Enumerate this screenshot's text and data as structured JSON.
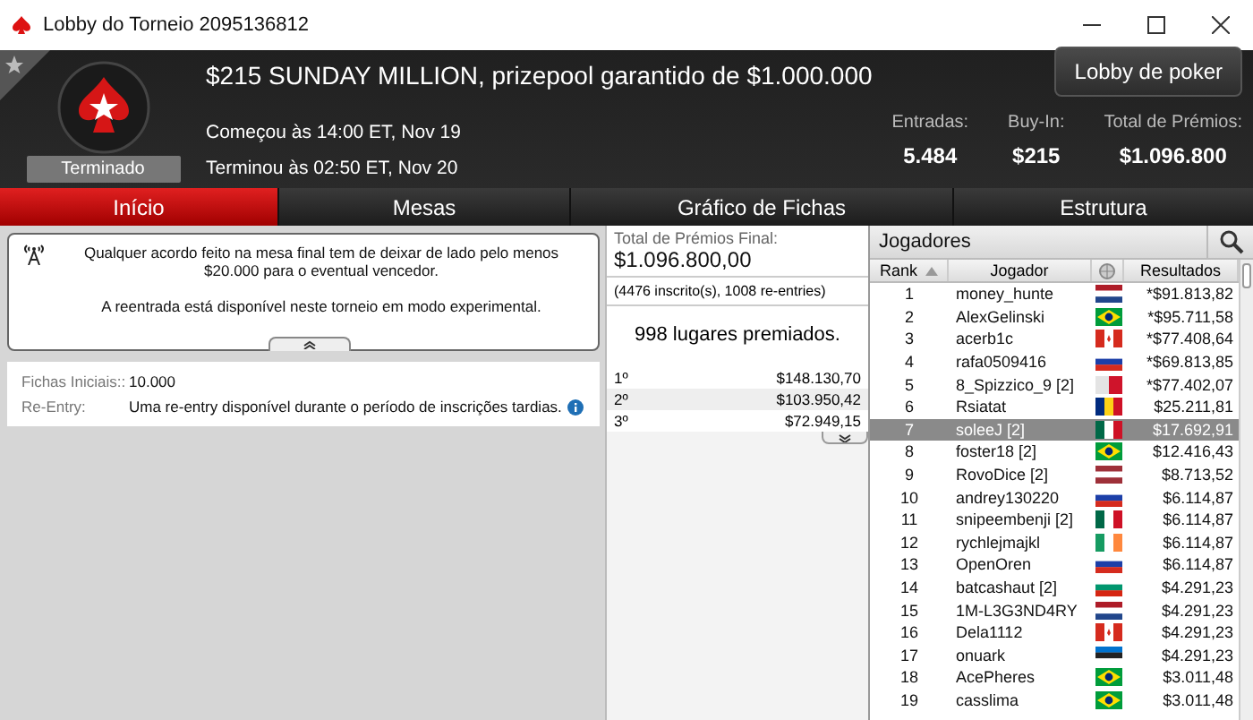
{
  "window": {
    "title": "Lobby do Torneio 2095136812"
  },
  "header": {
    "tournament_title": "$215 SUNDAY MILLION, prizepool garantido de $1.000.000",
    "status": "Terminado",
    "started": "Começou às 14:00 ET, Nov 19",
    "ended": "Terminou às 02:50 ET, Nov 20",
    "lobby_button": "Lobby de poker",
    "stats": [
      {
        "label": "Entradas:",
        "value": "5.484"
      },
      {
        "label": "Buy-In:",
        "value": "$215"
      },
      {
        "label": "Total de Prémios:",
        "value": "$1.096.800"
      }
    ]
  },
  "tabs": [
    {
      "label": "Início",
      "selected": true
    },
    {
      "label": "Mesas",
      "selected": false
    },
    {
      "label": "Gráfico de Fichas",
      "selected": false
    },
    {
      "label": "Estrutura",
      "selected": false
    }
  ],
  "notice": [
    "Qualquer acordo feito na mesa final tem de deixar de lado pelo menos $20.000 para o eventual vencedor.",
    "A reentrada está disponível neste torneio em modo experimental."
  ],
  "info": [
    {
      "label": "Fichas Iniciais::",
      "value": "10.000"
    },
    {
      "label": "Re-Entry:",
      "value": "Uma re-entry disponível durante o período de inscrições tardias."
    }
  ],
  "prizes": {
    "title": "Total de Prémios Final:",
    "total": "$1.096.800,00",
    "entries": "(4476 inscrito(s), 1008 re-entries)",
    "paid": "998 lugares premiados.",
    "places": [
      {
        "place": "1º",
        "amount": "$148.130,70"
      },
      {
        "place": "2º",
        "amount": "$103.950,42"
      },
      {
        "place": "3º",
        "amount": "$72.949,15"
      }
    ]
  },
  "players": {
    "title": "Jogadores",
    "columns": [
      "Rank",
      "Jogador",
      "Resultados"
    ],
    "rows": [
      {
        "rank": "1",
        "name": "money_hunte",
        "kind": "nl",
        "result": "*$91.813,82",
        "selected": false
      },
      {
        "rank": "2",
        "name": "AlexGelinski",
        "kind": "br",
        "result": "*$95.711,58",
        "selected": false
      },
      {
        "rank": "3",
        "name": "acerb1c",
        "kind": "ca",
        "result": "*$77.408,64",
        "selected": false
      },
      {
        "rank": "4",
        "name": "rafa0509416",
        "kind": "ru",
        "result": "*$69.813,85",
        "selected": false
      },
      {
        "rank": "5",
        "name": "8_Spizzico_9 [2]",
        "kind": "mt",
        "result": "*$77.402,07",
        "selected": false
      },
      {
        "rank": "6",
        "name": "Rsiatat",
        "kind": "ro",
        "result": "$25.211,81",
        "selected": false
      },
      {
        "rank": "7",
        "name": "soleeJ [2]",
        "kind": "mx",
        "result": "$17.692,91",
        "selected": true
      },
      {
        "rank": "8",
        "name": "foster18 [2]",
        "kind": "br",
        "result": "$12.416,43",
        "selected": false
      },
      {
        "rank": "9",
        "name": "RovoDice [2]",
        "kind": "lv",
        "result": "$8.713,52",
        "selected": false
      },
      {
        "rank": "10",
        "name": "andrey130220",
        "kind": "ru",
        "result": "$6.114,87",
        "selected": false
      },
      {
        "rank": "11",
        "name": "snipeembenji [2]",
        "kind": "mx",
        "result": "$6.114,87",
        "selected": false
      },
      {
        "rank": "12",
        "name": "rychlejmajkl",
        "kind": "ie",
        "result": "$6.114,87",
        "selected": false
      },
      {
        "rank": "13",
        "name": "OpenOren",
        "kind": "ru",
        "result": "$6.114,87",
        "selected": false
      },
      {
        "rank": "14",
        "name": "batcashaut [2]",
        "kind": "bg",
        "result": "$4.291,23",
        "selected": false
      },
      {
        "rank": "15",
        "name": "1M-L3G3ND4RY",
        "kind": "nl",
        "result": "$4.291,23",
        "selected": false
      },
      {
        "rank": "16",
        "name": "Dela1112",
        "kind": "ca",
        "result": "$4.291,23",
        "selected": false
      },
      {
        "rank": "17",
        "name": "onuark",
        "kind": "ee",
        "result": "$4.291,23",
        "selected": false
      },
      {
        "rank": "18",
        "name": "AcePheres",
        "kind": "br",
        "result": "$3.011,48",
        "selected": false
      },
      {
        "rank": "19",
        "name": "casslima",
        "kind": "br",
        "result": "$3.011,48",
        "selected": false
      }
    ]
  }
}
